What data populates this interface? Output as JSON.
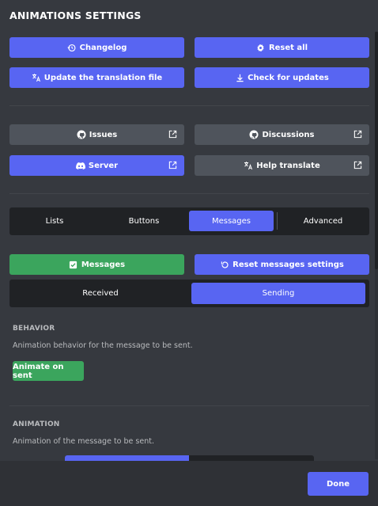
{
  "title": "ANIMATIONS SETTINGS",
  "top_buttons": {
    "changelog": "Changelog",
    "reset_all": "Reset all",
    "update_translation": "Update the translation file",
    "check_updates": "Check for updates"
  },
  "links": {
    "issues": "Issues",
    "discussions": "Discussions",
    "server": "Server",
    "help_translate": "Help translate"
  },
  "tabs": [
    "Lists",
    "Buttons",
    "Messages",
    "Advanced"
  ],
  "active_tab": "Messages",
  "messages_toggle": "Messages",
  "reset_messages": "Reset messages settings",
  "subtabs": [
    "Received",
    "Sending"
  ],
  "active_subtab": "Sending",
  "behavior": {
    "heading": "BEHAVIOR",
    "description": "Animation behavior for the message to be sent.",
    "button": "Animate on sent"
  },
  "animation": {
    "heading": "ANIMATION",
    "description": "Animation of the message to be sent."
  },
  "footer": {
    "done": "Done"
  },
  "colors": {
    "background": "#36393f",
    "blurple": "#5865f2",
    "grey_button": "#4f545c",
    "green": "#3ba55d",
    "dark": "#202225"
  }
}
